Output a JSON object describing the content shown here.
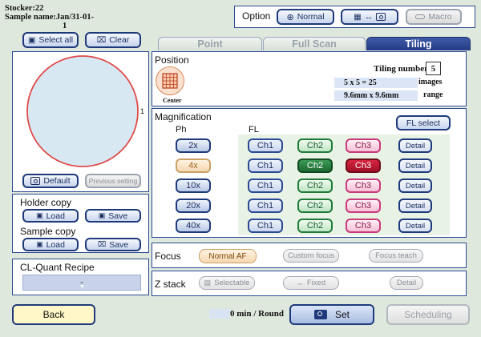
{
  "header": {
    "stocker": "Stocker:22",
    "sample_name": "Sample name:Jan/31-01-",
    "sample_name_cont": "1"
  },
  "option": {
    "label": "Option",
    "normal_label": "Normal",
    "macro_label": "Macro"
  },
  "select": {
    "select_all_label": "Select all",
    "clear_label": "Clear"
  },
  "tabs": [
    {
      "label": "Point"
    },
    {
      "label": "Full Scan"
    },
    {
      "label": "Tiling"
    }
  ],
  "vessel": {
    "marker": "1"
  },
  "left": {
    "default_label": "Default",
    "previous_label": "Previous setting",
    "holder_copy": "Holder copy",
    "sample_copy": "Sample copy",
    "load_label": "Load",
    "save_label": "Save",
    "recipe_title": "CL-Quant Recipe",
    "recipe_value": "-"
  },
  "position": {
    "title": "Position",
    "center_label": "Center",
    "tiling_number_label": "Tiling number",
    "tiling_number": "5",
    "images_value": "5 x 5 = 25",
    "images_label": "images",
    "range_value": "9.6mm x 9.6mm",
    "range_label": "range"
  },
  "magnification": {
    "title": "Magnification",
    "fl_select": "FL select",
    "ph_header": "Ph",
    "fl_header": "FL",
    "rows": [
      {
        "mag": "2x",
        "ch1": "Ch1",
        "ch2": "Ch2",
        "ch3": "Ch3",
        "detail": "Detail"
      },
      {
        "mag": "4x",
        "ch1": "Ch1",
        "ch2": "Ch2",
        "ch3": "Ch3",
        "detail": "Detail"
      },
      {
        "mag": "10x",
        "ch1": "Ch1",
        "ch2": "Ch2",
        "ch3": "Ch3",
        "detail": "Detail"
      },
      {
        "mag": "20x",
        "ch1": "Ch1",
        "ch2": "Ch2",
        "ch3": "Ch3",
        "detail": "Detail"
      },
      {
        "mag": "40x",
        "ch1": "Ch1",
        "ch2": "Ch2",
        "ch3": "Ch3",
        "detail": "Detail"
      }
    ]
  },
  "focus": {
    "title": "Focus",
    "normal_af": "Normal AF",
    "custom_focus": "Custom focus",
    "focus_teach": "Focus teach"
  },
  "zstack": {
    "title": "Z stack",
    "selectable": "Selectable",
    "fixed": "Fixed",
    "detail": "Detail"
  },
  "footer": {
    "back_label": "Back",
    "round_time": "0 min / Round",
    "set_label": "Set",
    "scheduling_label": "Scheduling"
  },
  "colors": {
    "background": "#dfe8dc",
    "panel_border": "#2b4a94",
    "tab_active": "#233c84",
    "vessel_outline": "#e04a4a",
    "vessel_fill": "#d8e8f3",
    "ch2_active": "#1e6a33",
    "ch3_active": "#a3122a",
    "back_button": "#fff7c8"
  }
}
